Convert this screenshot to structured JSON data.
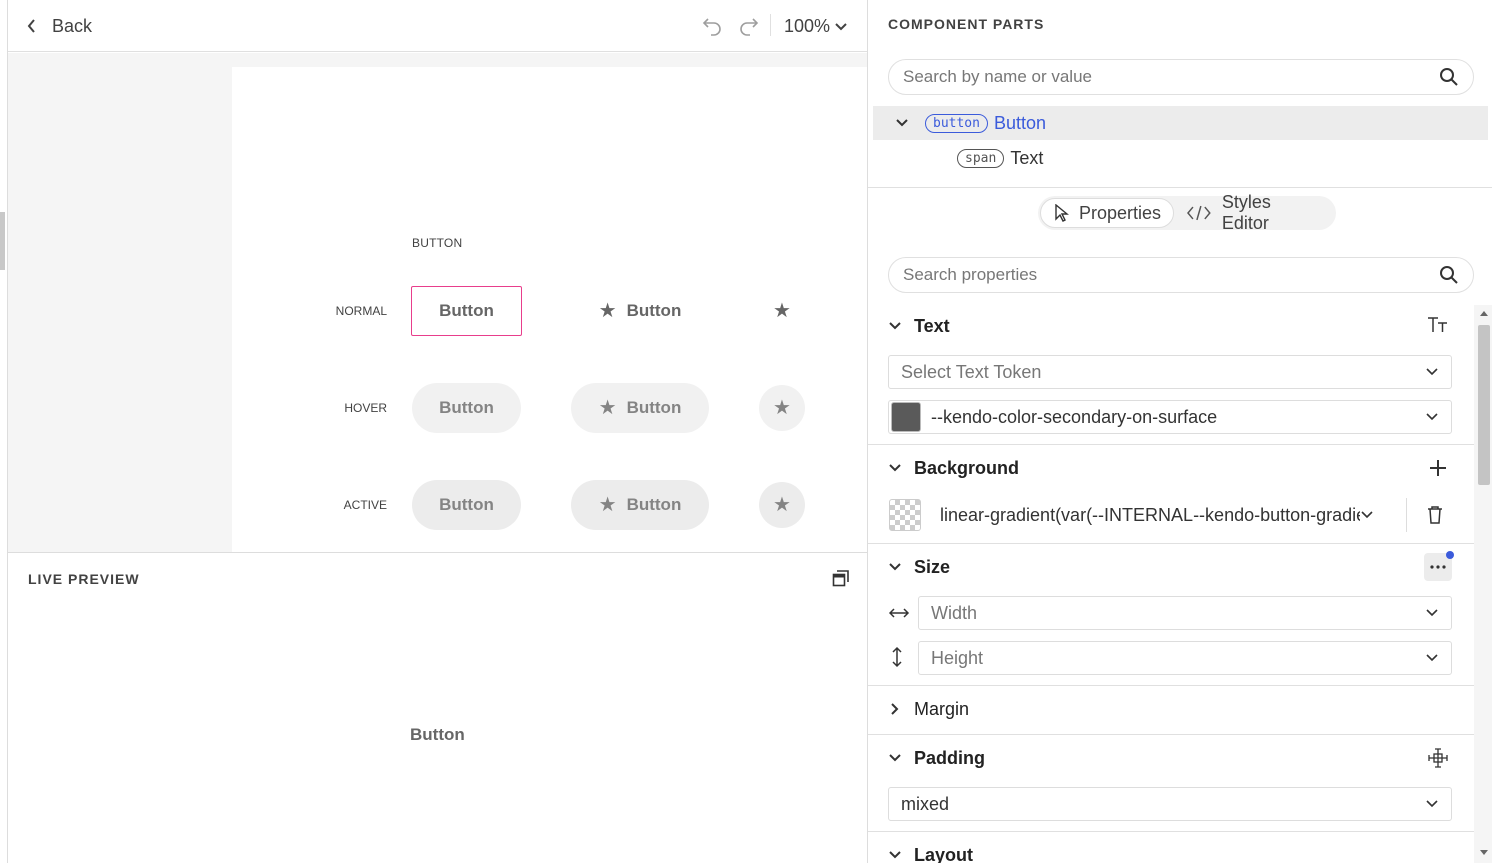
{
  "topbar": {
    "back_label": "Back",
    "zoom": "100%"
  },
  "canvas": {
    "column_title": "BUTTON",
    "rows": [
      {
        "label": "NORMAL",
        "button_text": "Button",
        "icon_button_text": "Button"
      },
      {
        "label": "HOVER",
        "button_text": "Button",
        "icon_button_text": "Button"
      },
      {
        "label": "ACTIVE",
        "button_text": "Button",
        "icon_button_text": "Button"
      }
    ]
  },
  "live_preview": {
    "title": "LIVE PREVIEW",
    "button_text": "Button"
  },
  "panel": {
    "title": "COMPONENT PARTS",
    "search_placeholder": "Search by name or value",
    "tree": [
      {
        "tag": "button",
        "name": "Button"
      },
      {
        "tag": "span",
        "name": "Text"
      }
    ],
    "tabs": [
      {
        "label": "Properties"
      },
      {
        "label": "Styles Editor"
      }
    ],
    "properties_placeholder": "Search properties",
    "sections": {
      "text": {
        "title": "Text",
        "token_placeholder": "Select Text Token",
        "color_value": "--kendo-color-secondary-on-surface",
        "color_swatch": "#5a5a5a"
      },
      "background": {
        "title": "Background",
        "value": "linear-gradient(var(--INTERNAL--kendo-button-gradient"
      },
      "size": {
        "title": "Size",
        "width_placeholder": "Width",
        "height_placeholder": "Height"
      },
      "margin": {
        "title": "Margin"
      },
      "padding": {
        "title": "Padding",
        "value": "mixed"
      },
      "layout": {
        "title": "Layout"
      }
    },
    "accent_color": "#3b5bdb",
    "selection_color": "#e83e8c"
  }
}
